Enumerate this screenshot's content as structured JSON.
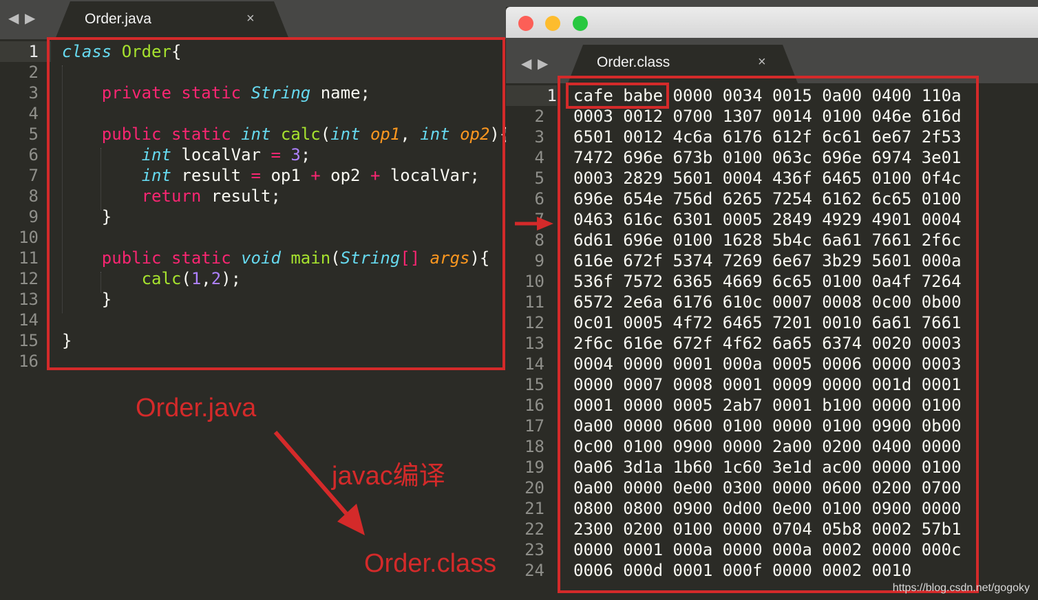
{
  "left_editor": {
    "tab_label": "Order.java",
    "close_glyph": "×",
    "nav_back": "◀",
    "nav_forward": "▶",
    "line_numbers": [
      "1",
      "2",
      "3",
      "4",
      "5",
      "6",
      "7",
      "8",
      "9",
      "10",
      "11",
      "12",
      "13",
      "14",
      "15",
      "16"
    ],
    "code_lines": [
      [
        [
          "ty",
          "class"
        ],
        [
          "",
          "",
          " "
        ],
        [
          "nm",
          "Order"
        ],
        [
          "",
          "{"
        ]
      ],
      [],
      [
        [
          "",
          "    "
        ],
        [
          "kw",
          "private"
        ],
        [
          "",
          " "
        ],
        [
          "kw",
          "static"
        ],
        [
          "",
          " "
        ],
        [
          "ty",
          "String"
        ],
        [
          "",
          " name;"
        ]
      ],
      [],
      [
        [
          "",
          "    "
        ],
        [
          "kw",
          "public"
        ],
        [
          "",
          " "
        ],
        [
          "kw",
          "static"
        ],
        [
          "",
          " "
        ],
        [
          "ty",
          "int"
        ],
        [
          "",
          " "
        ],
        [
          "nm",
          "calc"
        ],
        [
          "",
          "("
        ],
        [
          "ty",
          "int"
        ],
        [
          "",
          " "
        ],
        [
          "pa",
          "op1"
        ],
        [
          "",
          ", "
        ],
        [
          "ty",
          "int"
        ],
        [
          "",
          " "
        ],
        [
          "pa",
          "op2"
        ],
        [
          "",
          "){"
        ]
      ],
      [
        [
          "",
          "        "
        ],
        [
          "ty",
          "int"
        ],
        [
          "",
          " localVar "
        ],
        [
          "kw",
          "="
        ],
        [
          "",
          " "
        ],
        [
          "nu",
          "3"
        ],
        [
          "",
          ";"
        ]
      ],
      [
        [
          "",
          "        "
        ],
        [
          "ty",
          "int"
        ],
        [
          "",
          " result "
        ],
        [
          "kw",
          "="
        ],
        [
          "",
          " op1 "
        ],
        [
          "kw",
          "+"
        ],
        [
          "",
          " op2 "
        ],
        [
          "kw",
          "+"
        ],
        [
          "",
          " localVar;"
        ]
      ],
      [
        [
          "",
          "        "
        ],
        [
          "kw",
          "return"
        ],
        [
          "",
          " result;"
        ]
      ],
      [
        [
          "",
          "    }"
        ]
      ],
      [],
      [
        [
          "",
          "    "
        ],
        [
          "kw",
          "public"
        ],
        [
          "",
          " "
        ],
        [
          "kw",
          "static"
        ],
        [
          "",
          " "
        ],
        [
          "ty",
          "void"
        ],
        [
          "",
          " "
        ],
        [
          "nm",
          "main"
        ],
        [
          "",
          "("
        ],
        [
          "ty",
          "String"
        ],
        [
          "kw",
          "[]"
        ],
        [
          "",
          " "
        ],
        [
          "pa",
          "args"
        ],
        [
          "",
          "){"
        ]
      ],
      [
        [
          "",
          "        "
        ],
        [
          "nm",
          "calc"
        ],
        [
          "",
          "("
        ],
        [
          "nu",
          "1"
        ],
        [
          "",
          ","
        ],
        [
          "nu",
          "2"
        ],
        [
          "",
          ");"
        ]
      ],
      [
        [
          "",
          "    }"
        ]
      ],
      [],
      [
        [
          "",
          "}"
        ]
      ],
      []
    ]
  },
  "right_editor": {
    "tab_label": "Order.class",
    "close_glyph": "×",
    "nav_back": "◀",
    "nav_forward": "▶",
    "window_controls": {
      "close": "#fc5f57",
      "minimize": "#fdbc2e",
      "zoom": "#28c840"
    },
    "line_numbers": [
      "1",
      "2",
      "3",
      "4",
      "5",
      "6",
      "7",
      "8",
      "9",
      "10",
      "11",
      "12",
      "13",
      "14",
      "15",
      "16",
      "17",
      "18",
      "19",
      "20",
      "21",
      "22",
      "23",
      "24"
    ],
    "hex_lines": [
      "cafe babe 0000 0034 0015 0a00 0400 110a",
      "0003 0012 0700 1307 0014 0100 046e 616d",
      "6501 0012 4c6a 6176 612f 6c61 6e67 2f53",
      "7472 696e 673b 0100 063c 696e 6974 3e01",
      "0003 2829 5601 0004 436f 6465 0100 0f4c",
      "696e 654e 756d 6265 7254 6162 6c65 0100",
      "0463 616c 6301 0005 2849 4929 4901 0004",
      "6d61 696e 0100 1628 5b4c 6a61 7661 2f6c",
      "616e 672f 5374 7269 6e67 3b29 5601 000a",
      "536f 7572 6365 4669 6c65 0100 0a4f 7264",
      "6572 2e6a 6176 610c 0007 0008 0c00 0b00",
      "0c01 0005 4f72 6465 7201 0010 6a61 7661",
      "2f6c 616e 672f 4f62 6a65 6374 0020 0003",
      "0004 0000 0001 000a 0005 0006 0000 0003",
      "0000 0007 0008 0001 0009 0000 001d 0001",
      "0001 0000 0005 2ab7 0001 b100 0000 0100",
      "0a00 0000 0600 0100 0000 0100 0900 0b00",
      "0c00 0100 0900 0000 2a00 0200 0400 0000",
      "0a06 3d1a 1b60 1c60 3e1d ac00 0000 0100",
      "0a00 0000 0e00 0300 0000 0600 0200 0700",
      "0800 0800 0900 0d00 0e00 0100 0900 0000",
      "2300 0200 0100 0000 0704 05b8 0002 57b1",
      "0000 0001 000a 0000 000a 0002 0000 000c",
      "0006 000d 0001 000f 0000 0002 0010"
    ]
  },
  "annotations": {
    "source_label": "Order.java",
    "compile_label": "javac编译",
    "output_label": "Order.class",
    "accent_color": "#d42a2a"
  },
  "watermark": "https://blog.csdn.net/gogoky"
}
